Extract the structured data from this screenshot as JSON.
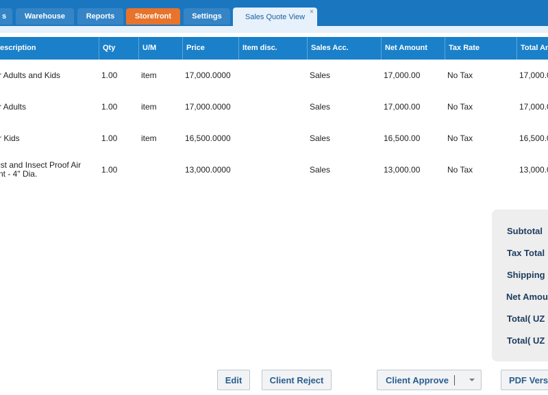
{
  "tabs": [
    {
      "label": "s"
    },
    {
      "label": "Warehouse"
    },
    {
      "label": "Reports"
    },
    {
      "label": "Storefront"
    },
    {
      "label": "Settings"
    },
    {
      "label": "Sales Quote View",
      "close": "×"
    }
  ],
  "columns": [
    "escription",
    "Qty",
    "U/M",
    "Price",
    "Item disc.",
    "Sales Acc.",
    "Net Amount",
    "Tax Rate",
    "Total An"
  ],
  "rows": [
    {
      "desc": "r Adults and Kids",
      "qty": "1.00",
      "um": "item",
      "price": "17,000.0000",
      "disc": "",
      "acc": "Sales",
      "net": "17,000.00",
      "tax": "No Tax",
      "total": "17,000.0"
    },
    {
      "desc": "r Adults",
      "qty": "1.00",
      "um": "item",
      "price": "17,000.0000",
      "disc": "",
      "acc": "Sales",
      "net": "17,000.00",
      "tax": "No Tax",
      "total": "17,000.0"
    },
    {
      "desc": "r Kids",
      "qty": "1.00",
      "um": "item",
      "price": "16,500.0000",
      "disc": "",
      "acc": "Sales",
      "net": "16,500.00",
      "tax": "No Tax",
      "total": "16,500.0"
    },
    {
      "desc": "ist and Insect Proof Air\nnt - 4\" Dia.",
      "qty": "1.00",
      "um": "",
      "price": "13,000.0000",
      "disc": "",
      "acc": "Sales",
      "net": "13,000.00",
      "tax": "No Tax",
      "total": "13,000.0"
    }
  ],
  "totals": {
    "subtotal": "Subtotal",
    "tax_total": "Tax Total",
    "shipping": "Shipping",
    "net_amount": "Net Amou",
    "total_1": "Total( UZ",
    "total_2": "Total( UZ"
  },
  "buttons": {
    "edit": "Edit",
    "client_reject": "Client Reject",
    "client_approve": "Client Approve",
    "pdf": "PDF Vers"
  },
  "colors": {
    "tab_bar": "#1b76c0",
    "grid_header": "#1a80c9",
    "orange_tab": "#e8732a",
    "button_text": "#2a5d8f"
  }
}
